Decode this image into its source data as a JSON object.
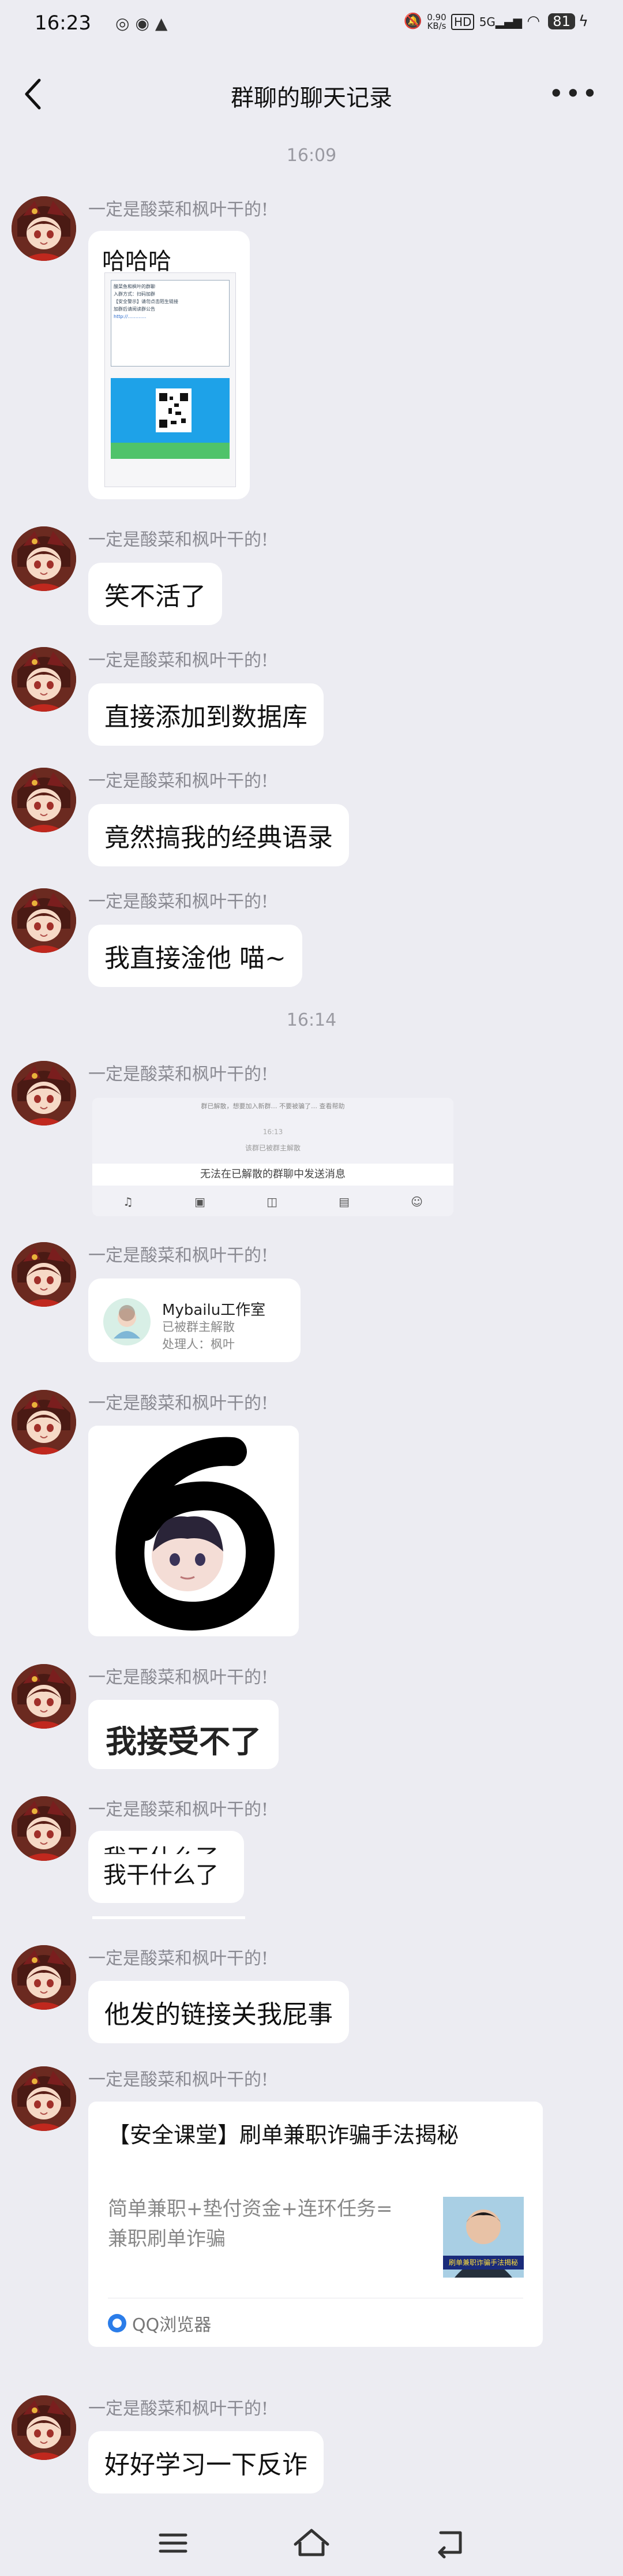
{
  "status": {
    "time": "16:23",
    "net_speed_top": "0.90",
    "net_speed_bottom": "KB/s",
    "hd": "HD",
    "signal": "5G",
    "battery": "81"
  },
  "header": {
    "title": "群聊的聊天记录"
  },
  "sender": "一定是酸菜和枫叶干的!",
  "timestamps": [
    "16:09",
    "16:14"
  ],
  "messages": {
    "m1_text": "哈哈哈",
    "m2_text": "笑不活了",
    "m3_text": "直接添加到数据库",
    "m4_text": "竟然搞我的经典语录",
    "m5_text": "我直接淦他 喵~",
    "m7_group": "Mybailu工作室",
    "m7_status": "已被群主解散",
    "m7_handler": "处理人：枫叶",
    "m9_text": "我接受不了",
    "m10_text": "我干什么了",
    "m11_text": "他发的链接关我屁事",
    "m13_text": "好好学习一下反诈"
  },
  "embedded_screenshot": {
    "notice": "群已解散，想要加入新群… 不要被骗了… 查看帮助",
    "time": "16:13",
    "system": "该群已被群主解散",
    "banner": "无法在已解散的群聊中发送消息"
  },
  "qr_card": {
    "lines": [
      "酸菜鱼和枫叶的群聊",
      "入群方式：扫码加群",
      "【安全警示】请勿点击陌生链接",
      "加群后请阅读群公告"
    ]
  },
  "link_card": {
    "title": "【安全课堂】刷单兼职诈骗手法揭秘",
    "desc": "简单兼职+垫付资金+连环任务=兼职刷单诈骗",
    "thumb_caption": "刷单兼职诈骗手法揭秘",
    "source": "QQ浏览器"
  },
  "colors": {
    "background": "#ececf2",
    "bubble": "#ffffff",
    "accent": "#2b7de9"
  }
}
